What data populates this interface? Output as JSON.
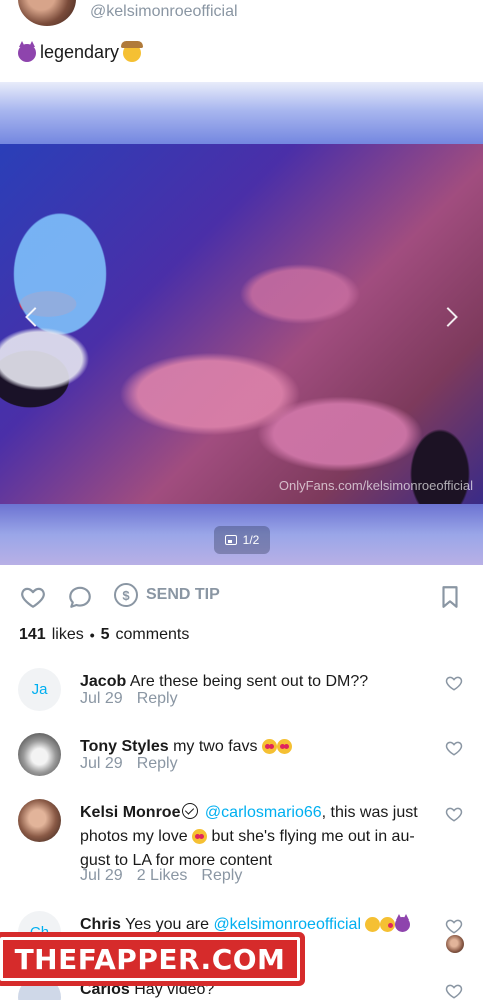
{
  "post": {
    "handle": "@kelsimonroeofficial",
    "caption": "legendary",
    "media_counter": "1/2",
    "watermark": "OnlyFans.com/kelsimonroeofficial"
  },
  "actions": {
    "send_tip_label": "SEND TIP",
    "tip_symbol": "$"
  },
  "stats": {
    "likes_count": "141",
    "likes_label": "likes",
    "separator": "•",
    "comments_count": "5",
    "comments_label": "comments"
  },
  "comments": [
    {
      "initials": "Ja",
      "author": "Jacob",
      "text": "Are these being sent out to DM??",
      "date": "Jul 29",
      "reply_label": "Reply"
    },
    {
      "author": "Tony Styles",
      "text": "my two favs",
      "date": "Jul 29",
      "reply_label": "Reply"
    },
    {
      "author": "Kelsi Monroe",
      "mention": "@carlosmario66",
      "text_line1": ", this was just",
      "text_line2": "photos my love",
      "text_line2b": "but she's flying me out in au-",
      "text_line3": "gust to LA for more content",
      "date": "Jul 29",
      "likes": "2 Likes",
      "reply_label": "Reply"
    },
    {
      "initials": "Ch",
      "author": "Chris",
      "text": "Yes you are",
      "mention": "@kelsimonroeofficial"
    },
    {
      "author": "Carlos",
      "text": "Hay video?"
    }
  ],
  "banner": {
    "text": "THEFAPPER.COM"
  },
  "colors": {
    "accent": "#00aff0",
    "muted": "#8a96a3",
    "banner_red": "#d62b2b"
  },
  "icons": [
    "heart-icon",
    "comment-icon",
    "dollar-icon",
    "bookmark-icon",
    "image-icon",
    "chevron-left-icon",
    "chevron-right-icon",
    "verified-icon"
  ]
}
